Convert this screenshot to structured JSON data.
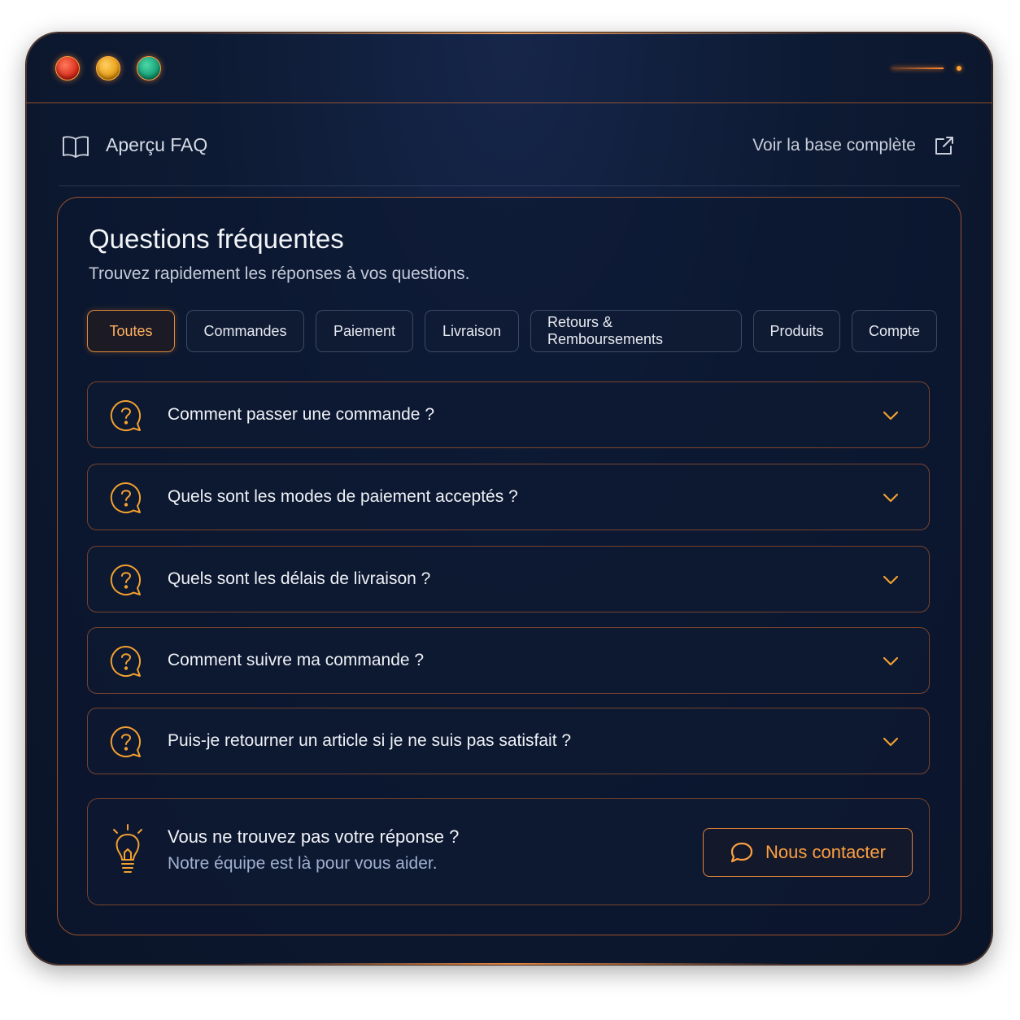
{
  "header": {
    "title": "Aperçu FAQ",
    "link_label": "Voir la base complète"
  },
  "faq": {
    "title": "Questions fréquentes",
    "subtitle": "Trouvez rapidement les réponses à vos questions.",
    "tabs": [
      {
        "label": "Toutes",
        "active": true
      },
      {
        "label": "Commandes",
        "active": false
      },
      {
        "label": "Paiement",
        "active": false
      },
      {
        "label": "Livraison",
        "active": false
      },
      {
        "label": "Retours & Remboursements",
        "active": false
      },
      {
        "label": "Produits",
        "active": false
      },
      {
        "label": "Compte",
        "active": false
      }
    ],
    "questions": [
      {
        "text": "Comment passer une commande ?",
        "expanded": false
      },
      {
        "text": "Quels sont les modes de paiement acceptés ?",
        "expanded": false
      },
      {
        "text": "Quels sont les délais de livraison ?",
        "expanded": false
      },
      {
        "text": "Comment suivre ma commande ?",
        "expanded": false
      },
      {
        "text": "Puis-je retourner un article si je ne suis pas satisfait ?",
        "expanded": false
      }
    ]
  },
  "help": {
    "title": "Vous ne trouvez pas votre réponse ?",
    "subtitle": "Notre équipe est là pour vous aider.",
    "button_label": "Nous contacter"
  },
  "icons": {
    "header": "book-icon",
    "link": "external-link-icon",
    "question": "question-bubble-icon",
    "expand": "chevron-down-icon",
    "help": "lightbulb-icon",
    "contact": "chat-bubble-icon"
  },
  "colors": {
    "accent": "#ff9a40",
    "background": "#0d1a33",
    "window_red": "#d8291a",
    "window_yellow": "#e59a12",
    "window_green": "#109a72"
  }
}
